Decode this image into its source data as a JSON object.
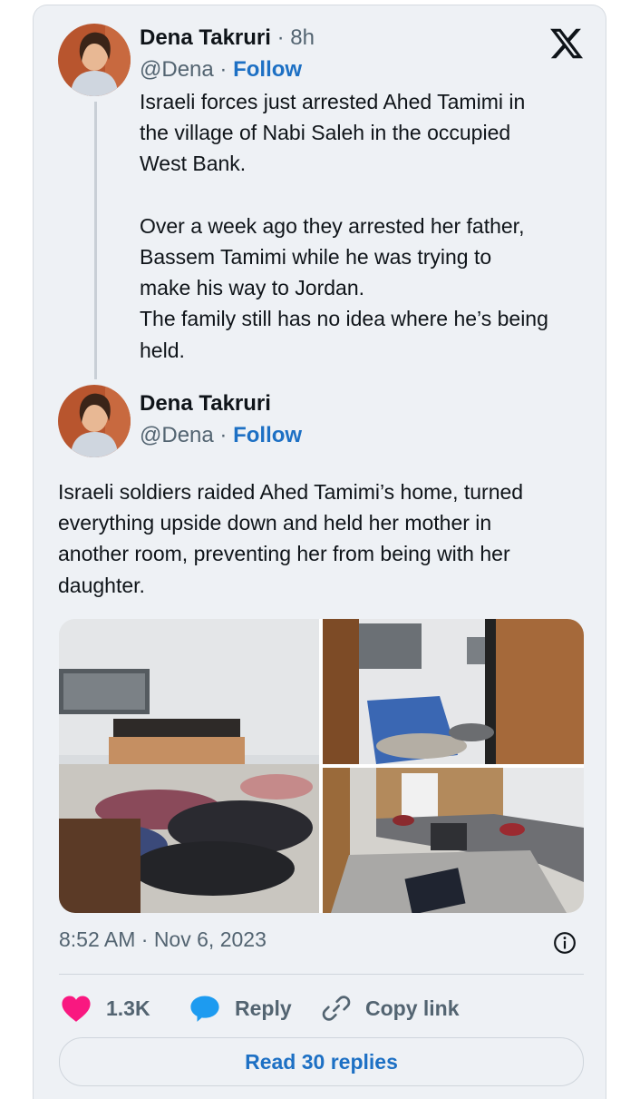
{
  "tweet1": {
    "name": "Dena Takruri",
    "time": "· 8h",
    "handle": "@Dena",
    "separator": "·",
    "follow": "Follow",
    "text": "Israeli forces just arrested Ahed Tamimi in\nthe village of Nabi Saleh in the occupied\nWest Bank.\n\nOver a week ago they arrested her father,\nBassem Tamimi while he was trying to\nmake his way to Jordan.\nThe family still has no idea where he’s being\nheld."
  },
  "tweet2": {
    "name": "Dena Takruri",
    "handle": "@Dena",
    "separator": "·",
    "follow": "Follow",
    "text": "Israeli soldiers raided Ahed Tamimi’s home, turned\neverything upside down and held her mother in\nanother room, preventing her from being with her\ndaughter."
  },
  "meta": {
    "timestamp": "8:52 AM · Nov 6, 2023"
  },
  "actions": {
    "likes": "1.3K",
    "reply": "Reply",
    "copy_link": "Copy link"
  },
  "read_replies": "Read 30 replies",
  "icons": {
    "logo": "x-logo-icon",
    "info": "info-icon",
    "like": "heart-icon",
    "reply": "speech-bubble-icon",
    "copy": "link-icon"
  },
  "colors": {
    "accent": "#1d70c4",
    "like": "#f91880",
    "reply": "#1d9bf0",
    "muted": "#536471",
    "card_bg": "#eef1f5"
  }
}
